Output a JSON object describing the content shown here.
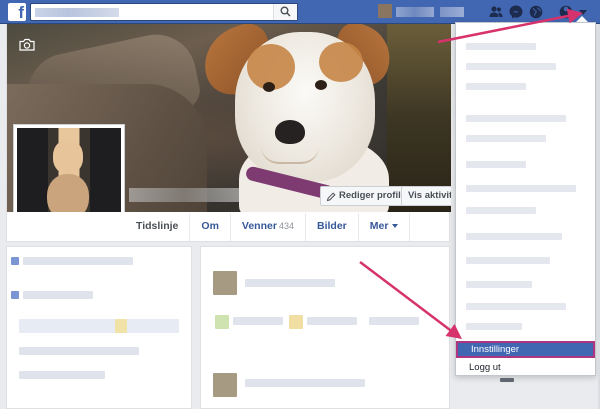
{
  "search": {
    "placeholder": ""
  },
  "profile": {
    "edit_profile_label": "Rediger profil",
    "view_activity_label": "Vis aktivitet"
  },
  "tabs": [
    {
      "label": "Tidslinje"
    },
    {
      "label": "Om"
    },
    {
      "label": "Venner",
      "count": "434"
    },
    {
      "label": "Bilder"
    },
    {
      "label": "Mer"
    }
  ],
  "menu": {
    "settings_label": "Innstillinger",
    "logout_label": "Logg ut"
  },
  "colors": {
    "brand_blue": "#4267b2",
    "annotation_arrow": "#d6336c",
    "highlight_border": "#b0357f"
  },
  "icons": [
    "facebook-logo-icon",
    "search-icon",
    "friends-icon",
    "messenger-icon",
    "globe-icon",
    "help-icon",
    "dropdown-caret-icon",
    "camera-icon",
    "pencil-icon",
    "more-icon"
  ]
}
